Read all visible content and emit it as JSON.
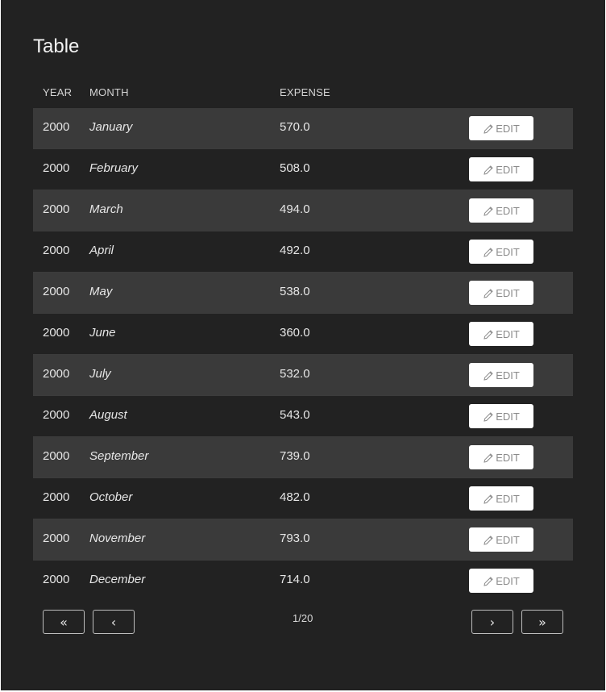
{
  "title": "Table",
  "table": {
    "headers": {
      "year": "YEAR",
      "month": "MONTH",
      "expense": "EXPENSE"
    },
    "rows": [
      {
        "year": "2000",
        "month": "January",
        "expense": "570.0",
        "action": "EDIT"
      },
      {
        "year": "2000",
        "month": "February",
        "expense": "508.0",
        "action": "EDIT"
      },
      {
        "year": "2000",
        "month": "March",
        "expense": "494.0",
        "action": "EDIT"
      },
      {
        "year": "2000",
        "month": "April",
        "expense": "492.0",
        "action": "EDIT"
      },
      {
        "year": "2000",
        "month": "May",
        "expense": "538.0",
        "action": "EDIT"
      },
      {
        "year": "2000",
        "month": "June",
        "expense": "360.0",
        "action": "EDIT"
      },
      {
        "year": "2000",
        "month": "July",
        "expense": "532.0",
        "action": "EDIT"
      },
      {
        "year": "2000",
        "month": "August",
        "expense": "543.0",
        "action": "EDIT"
      },
      {
        "year": "2000",
        "month": "September",
        "expense": "739.0",
        "action": "EDIT"
      },
      {
        "year": "2000",
        "month": "October",
        "expense": "482.0",
        "action": "EDIT"
      },
      {
        "year": "2000",
        "month": "November",
        "expense": "793.0",
        "action": "EDIT"
      },
      {
        "year": "2000",
        "month": "December",
        "expense": "714.0",
        "action": "EDIT"
      }
    ]
  },
  "pagination": {
    "first": "«",
    "prev": "‹",
    "page_info": "1/20",
    "next": "›",
    "last": "»"
  },
  "icons": {
    "edit": "pencil-icon"
  },
  "colors": {
    "background": "#222222",
    "row_stripe": "#3a3a3a",
    "button_bg": "#ffffff",
    "text": "#e6e6e6"
  }
}
